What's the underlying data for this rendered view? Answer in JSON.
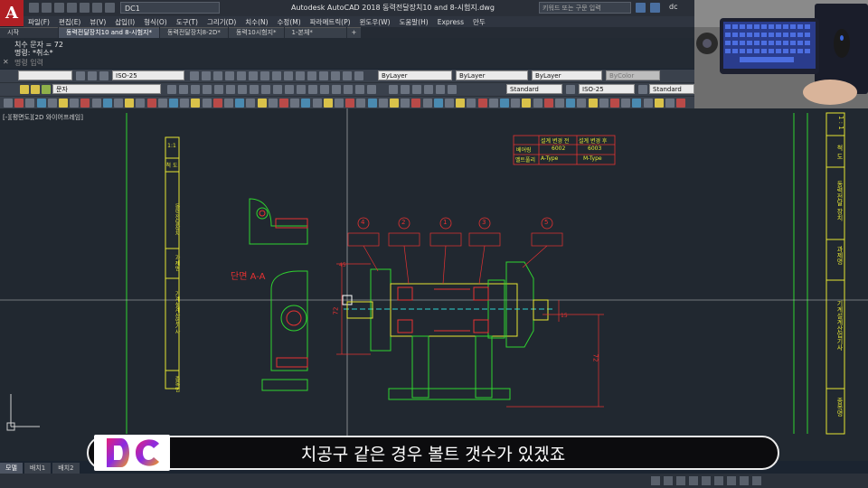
{
  "app": {
    "logo_letter": "A",
    "title": "Autodesk AutoCAD 2018    동력전달장치10 and 8-시험지.dwg",
    "workspace": "DC1",
    "search_placeholder": "키워드 또는 구문 입력",
    "user": "dc"
  },
  "menu": [
    "파일(F)",
    "편집(E)",
    "뷰(V)",
    "삽입(I)",
    "형식(O)",
    "도구(T)",
    "그리기(D)",
    "치수(N)",
    "수정(M)",
    "파라메트릭(P)",
    "윈도우(W)",
    "도움말(H)",
    "Express",
    "만두"
  ],
  "file_tabs": [
    {
      "label": "시작",
      "active": false
    },
    {
      "label": "동력전달장치10 and 8-시험지*",
      "active": true
    },
    {
      "label": "동력전달장치8-2D*",
      "active": false
    },
    {
      "label": "동력10시험지*",
      "active": false
    },
    {
      "label": "1-본체*",
      "active": false
    }
  ],
  "command": {
    "line1": "치수 문자 = 72",
    "line2": "명령: *취소*",
    "input_placeholder": "명령 입력"
  },
  "toolbar": {
    "dimstyle_1": "ISO-25",
    "layer": "문자",
    "color": "ByLayer",
    "linetype": "ByLayer",
    "lineweight": "ByLayer",
    "plotstyle": "ByColor",
    "textstyle": "Standard",
    "dimstyle_2": "ISO-25",
    "tablestyle": "Standard"
  },
  "viewport_label": "[-][평면도][2D 와이어프레임]",
  "drawing": {
    "section_label": "단면 A-A",
    "dim_72_left": "72",
    "dim_72_right": "72",
    "dim_45": "45",
    "dim_15": "15",
    "change_table": {
      "header_before": "설계 변경 전",
      "header_after": "설계 변경 후",
      "row1_label": "베어링",
      "row1_before": "6002",
      "row1_after": "6003",
      "row2_label": "벨트풀리",
      "row2_before": "A-Type",
      "row2_after": "M-Type"
    },
    "balloons": [
      "4",
      "2",
      "1",
      "3",
      "5"
    ],
    "title_strip_left": [
      "1:1",
      "척 도",
      "동력전달장치",
      "과제명",
      "기계설계산업기사",
      "종목명"
    ],
    "title_strip_right": [
      "1 : 1",
      "척 도",
      "동력전달 장치",
      "과제명",
      "기계설계산업기사",
      "종목명"
    ]
  },
  "layout_tabs": [
    "모델",
    "배치1",
    "배치2"
  ],
  "subtitle": "치공구 같은 경우 볼트 갯수가 있겠죠",
  "colors": {
    "canvas": "#212830",
    "green": "#2fd32f",
    "red": "#e63232",
    "yellow": "#e6e632",
    "cyan": "#2fd3d3"
  }
}
